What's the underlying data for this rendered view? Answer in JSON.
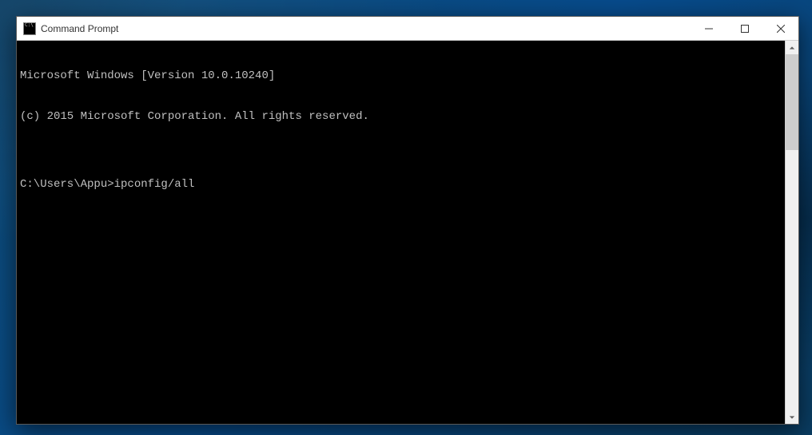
{
  "window": {
    "title": "Command Prompt"
  },
  "terminal": {
    "header_line1": "Microsoft Windows [Version 10.0.10240]",
    "header_line2": "(c) 2015 Microsoft Corporation. All rights reserved.",
    "blank": "",
    "prompt": "C:\\Users\\Appu>",
    "command": "ipconfig/all"
  }
}
